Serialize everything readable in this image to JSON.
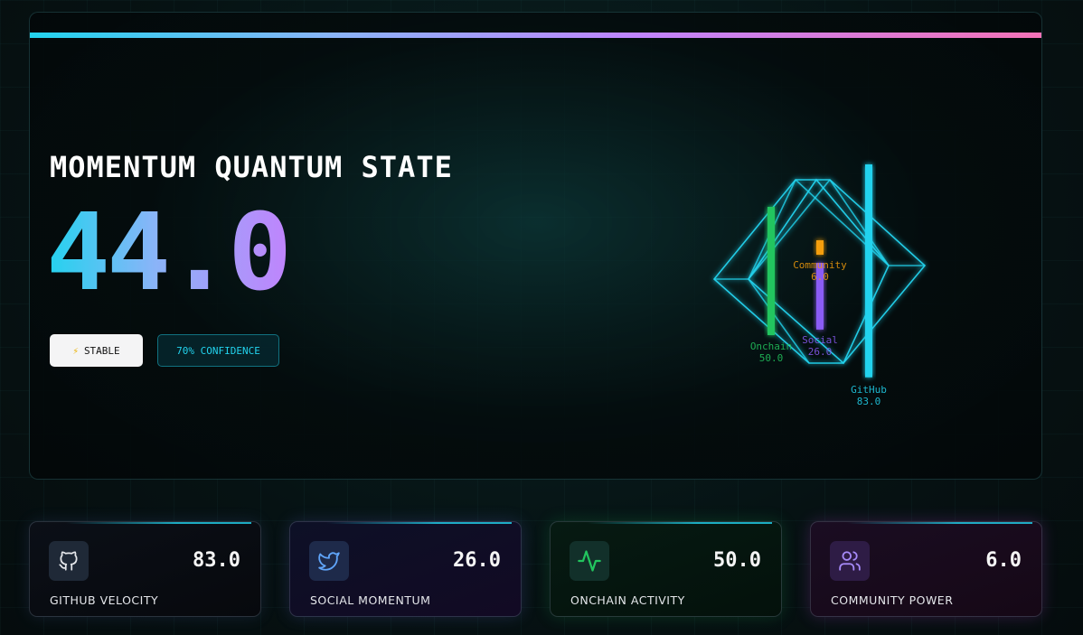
{
  "hero": {
    "title": "MOMENTUM QUANTUM STATE",
    "score": "44.0",
    "status_icon": "lightning-bolt-icon",
    "status_label": "STABLE",
    "confidence_label": "70% CONFIDENCE"
  },
  "chart_data": {
    "type": "bar",
    "categories": [
      "Onchain",
      "Social",
      "Community",
      "GitHub"
    ],
    "values": [
      50.0,
      26.0,
      6.0,
      83.0
    ],
    "value_labels": [
      "50.0",
      "26.0",
      "6.0",
      "83.0"
    ],
    "colors": [
      "#22c55e",
      "#8b5cf6",
      "#f59e0b",
      "#22d3ee"
    ],
    "frame_color": "#22d3ee"
  },
  "metrics": [
    {
      "label": "GITHUB VELOCITY",
      "value": "83.0",
      "icon": "github-icon",
      "color": "#e5e7eb"
    },
    {
      "label": "SOCIAL MOMENTUM",
      "value": "26.0",
      "icon": "twitter-icon",
      "color": "#60a5fa"
    },
    {
      "label": "ONCHAIN ACTIVITY",
      "value": "50.0",
      "icon": "activity-pulse-icon",
      "color": "#22c55e"
    },
    {
      "label": "COMMUNITY POWER",
      "value": "6.0",
      "icon": "users-icon",
      "color": "#a78bfa"
    }
  ]
}
